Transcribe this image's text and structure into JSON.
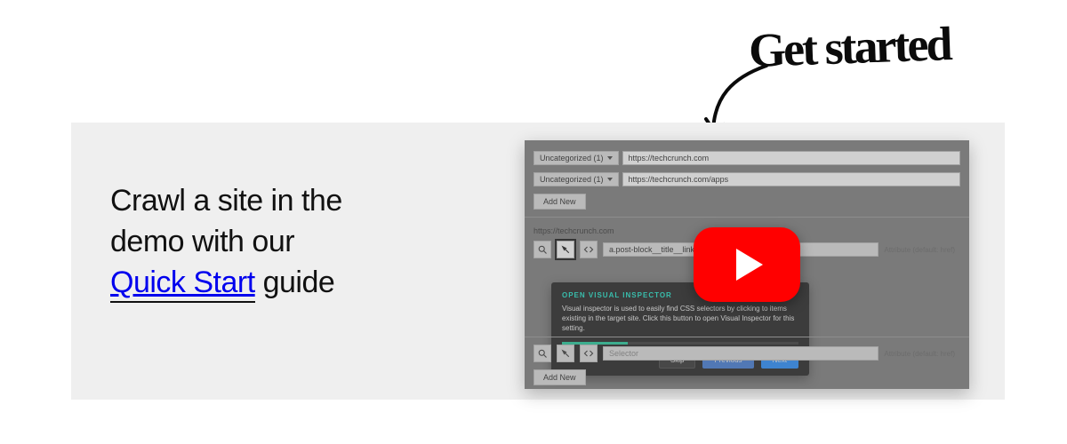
{
  "annotation": {
    "text": "Get started"
  },
  "tagline": {
    "line1": "Crawl a site in the",
    "line2": "demo with our",
    "link_text": "Quick Start",
    "line3_suffix": " guide"
  },
  "video": {
    "rows": [
      {
        "dropdown": "Uncategorized (1)",
        "url": "https://techcrunch.com"
      },
      {
        "dropdown": "Uncategorized (1)",
        "url": "https://techcrunch.com/apps"
      }
    ],
    "add_new": "Add New",
    "section_url": "https://techcrunch.com",
    "selector_row": {
      "selector": "a.post-block__title__link",
      "attr_hint": "Attribute (default: href)"
    },
    "tooltip": {
      "title": "OPEN VISUAL INSPECTOR",
      "body": "Visual inspector is used to easily find CSS selectors by clicking to items existing in the target site. Click this button to open Visual Inspector for this setting.",
      "skip": "Skip",
      "previous": "Previous",
      "next": "Next"
    },
    "bottom_selector": {
      "placeholder": "Selector",
      "attr_hint": "Attribute (default: href)"
    },
    "add_new_bottom": "Add New"
  }
}
